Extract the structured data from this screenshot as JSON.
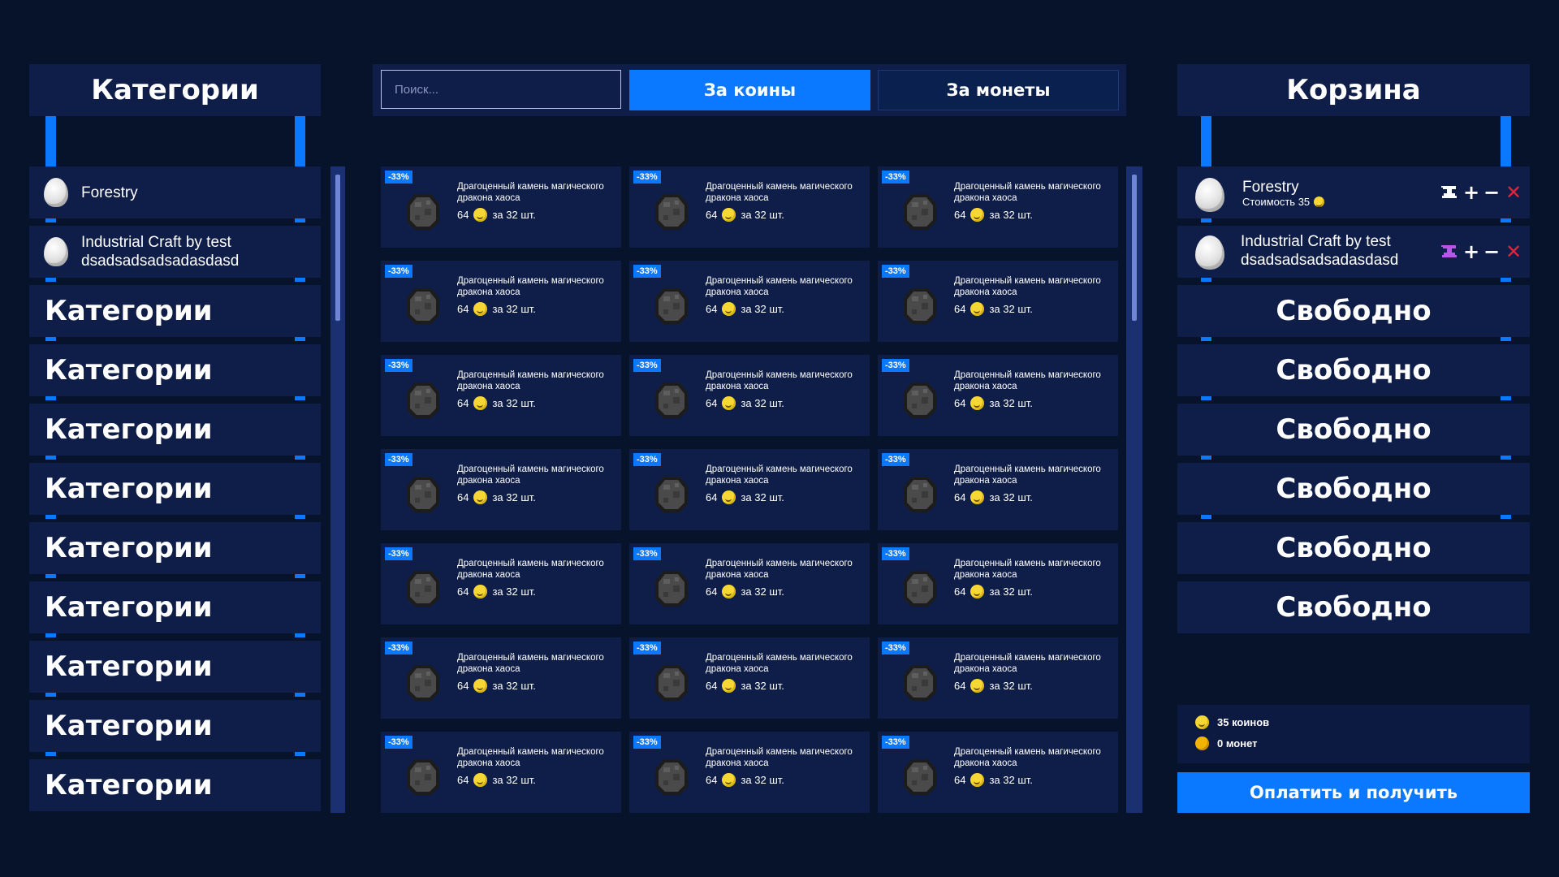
{
  "categories": {
    "title": "Категории",
    "items": [
      {
        "label": "Forestry",
        "icon": "egg-icon"
      },
      {
        "label": "Industrial Craft by test dsadsadsadsadasdasd",
        "icon": "egg-icon"
      },
      {
        "label": "Категории"
      },
      {
        "label": "Категории"
      },
      {
        "label": "Категории"
      },
      {
        "label": "Категории"
      },
      {
        "label": "Категории"
      },
      {
        "label": "Категории"
      },
      {
        "label": "Категории"
      },
      {
        "label": "Категории"
      },
      {
        "label": "Категории"
      }
    ]
  },
  "search": {
    "placeholder": "Поиск..."
  },
  "tabs": {
    "coins": "За коины",
    "money": "За монеты"
  },
  "product": {
    "badge": "-33%",
    "title": "Драгоценный камень магического дракона хаоса",
    "amount": "64",
    "per": "за 32 шт.",
    "icon": "stone-icon",
    "count": 21
  },
  "cart": {
    "title": "Корзина",
    "items": [
      {
        "name": "Forestry",
        "price_text": "Стоимость 35"
      },
      {
        "name": "Industrial Craft by test dsadsadsadsadasdasd"
      }
    ],
    "free_label": "Свободно",
    "free_slots": 6,
    "totals": {
      "coins": "35 коинов",
      "money": "0 монет"
    },
    "pay_button": "Оплатить и получить"
  },
  "colors": {
    "accent": "#0a78ff",
    "background": "#07132b",
    "panel": "#0f1e48",
    "danger": "#e3243a"
  }
}
